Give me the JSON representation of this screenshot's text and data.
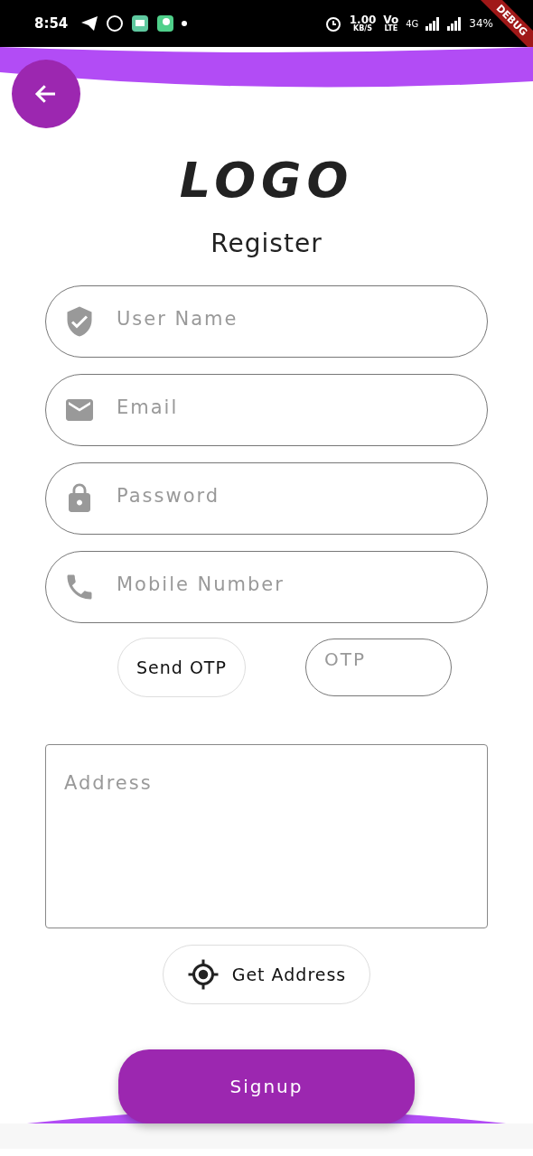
{
  "status_bar": {
    "time": "8:54",
    "speed": "1.00",
    "speed_unit": "KB/S",
    "volte_top": "Vo",
    "volte_bottom": "LTE",
    "network": "4G",
    "battery": "34%"
  },
  "debug_banner": "DEBUG",
  "logo": "LOGO",
  "title": "Register",
  "fields": [
    {
      "kind": "shield",
      "placeholder": "User Name"
    },
    {
      "kind": "mail",
      "placeholder": "Email"
    },
    {
      "kind": "lock",
      "placeholder": "Password"
    },
    {
      "kind": "phone",
      "placeholder": "Mobile Number"
    }
  ],
  "send_otp_button": "Send OTP",
  "otp_field": {
    "placeholder": "OTP"
  },
  "address_field": {
    "placeholder": "Address"
  },
  "get_address_button": "Get Address",
  "signup_button": "Signup"
}
